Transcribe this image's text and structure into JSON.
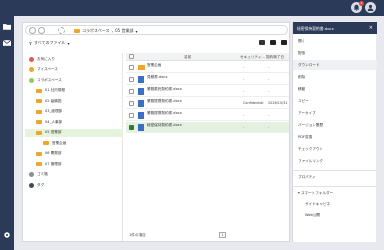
{
  "topbar": {
    "notification_count": "1"
  },
  "pathbar": {
    "crumbs": [
      "コラボスペース",
      "05 営業部"
    ]
  },
  "filter": {
    "label": "すべてのファイル"
  },
  "tree": [
    {
      "label": "お気に入り",
      "color": "#e5574f",
      "kind": "circle",
      "indent": 0
    },
    {
      "label": "マイスペース",
      "color": "#f0a52b",
      "kind": "circle",
      "indent": 0
    },
    {
      "label": "コラボスペース",
      "color": "#8fcb5a",
      "kind": "circle",
      "indent": 0
    },
    {
      "label": "01 社内規程",
      "color": "#f0a52b",
      "kind": "folder",
      "indent": 1
    },
    {
      "label": "02 組織図",
      "color": "#f0a52b",
      "kind": "folder",
      "indent": 1
    },
    {
      "label": "03_経理部",
      "color": "#f0a52b",
      "kind": "folder",
      "indent": 1
    },
    {
      "label": "04_人事部",
      "color": "#f0a52b",
      "kind": "folder",
      "indent": 1
    },
    {
      "label": "05 営業部",
      "color": "#f0a52b",
      "kind": "folder",
      "indent": 1,
      "selected": true
    },
    {
      "label": "営業企画",
      "color": "#f0a52b",
      "kind": "folder",
      "indent": 2
    },
    {
      "label": "06 開発部",
      "color": "#f0a52b",
      "kind": "folder",
      "indent": 1
    },
    {
      "label": "07 管理部",
      "color": "#f0a52b",
      "kind": "folder",
      "indent": 1
    },
    {
      "label": "ゴミ箱",
      "color": "#8a8f99",
      "kind": "circle",
      "indent": 0
    },
    {
      "label": "タグ",
      "color": "#3d4a66",
      "kind": "circle",
      "indent": 0
    }
  ],
  "list": {
    "headers": {
      "name": "名前",
      "security": "セキュリティ...",
      "updated": "契約満了日"
    },
    "rows": [
      {
        "name": "営業企画",
        "meta": "",
        "security": "-",
        "updated": "-",
        "type": "folder",
        "checked": false
      },
      {
        "name": "見積書.docx",
        "meta": "",
        "security": "-",
        "updated": "-",
        "type": "doc",
        "checked": false
      },
      {
        "name": "業務委託契約書.docx",
        "meta": "",
        "security": "-",
        "updated": "-",
        "type": "doc",
        "checked": false
      },
      {
        "name": "業務提携契約書.docx",
        "meta": "",
        "security": "Confidential",
        "updated": "2026/10/31",
        "type": "doc",
        "checked": false
      },
      {
        "name": "業務提携契約書.docx",
        "meta": "",
        "security": "-",
        "updated": "-",
        "type": "doc",
        "checked": false
      },
      {
        "name": "秘密保持契約書.docx",
        "meta": "",
        "security": "-",
        "updated": "-",
        "type": "doc",
        "checked": true
      }
    ],
    "status": "1件の項目",
    "page": "1"
  },
  "panel": {
    "title": "秘密保持契約書.docx",
    "items": [
      {
        "label": "開く",
        "active": false
      },
      {
        "label": "配信",
        "active": false
      },
      {
        "label": "ダウンロード",
        "active": true
      },
      {
        "label": "削除",
        "active": false
      },
      {
        "label": "移動",
        "active": false
      },
      {
        "label": "コピー",
        "active": false
      },
      {
        "label": "アーカイブ",
        "active": false
      },
      {
        "label": "バージョン履歴",
        "active": false
      },
      {
        "label": "PDF変換",
        "active": false
      },
      {
        "label": "チェックアウト",
        "active": false
      },
      {
        "label": "ファイルリンク",
        "active": false
      }
    ],
    "properties_label": "プロパティ",
    "smart_folder_label": "スマートフォルダー",
    "sub_items": [
      "サイドキャビネ",
      "Web公開"
    ]
  }
}
